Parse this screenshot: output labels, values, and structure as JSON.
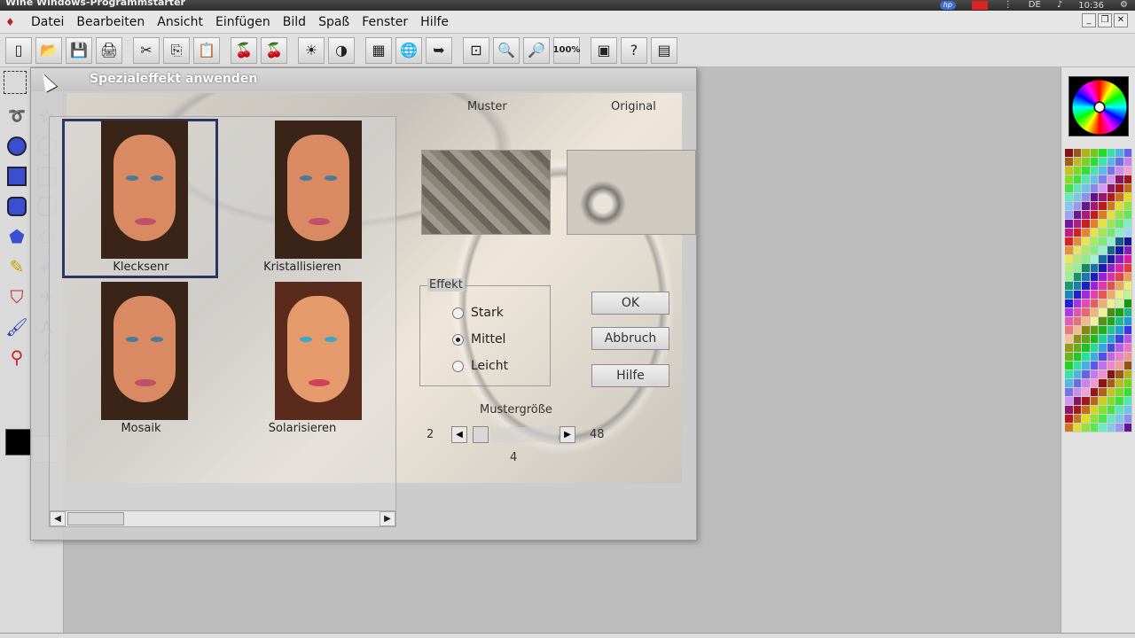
{
  "titlebar": {
    "title": "Wine Windows-Programmstarter",
    "tray": [
      "hp",
      "",
      "",
      "DE",
      "",
      "10:36"
    ]
  },
  "menu": {
    "items": [
      "Datei",
      "Bearbeiten",
      "Ansicht",
      "Einfügen",
      "Bild",
      "Spaß",
      "Fenster",
      "Hilfe"
    ]
  },
  "toolbar": {
    "buttons": [
      {
        "icon": "new-document-icon",
        "glyph": "▯"
      },
      {
        "icon": "open-folder-icon",
        "glyph": "📂"
      },
      {
        "icon": "save-disk-icon",
        "glyph": "💾"
      },
      {
        "icon": "scanner-icon",
        "glyph": "🖨"
      },
      {
        "icon": "cut-scissors-icon",
        "glyph": "✂"
      },
      {
        "icon": "copy-icon",
        "glyph": "⎘"
      },
      {
        "icon": "paste-icon",
        "glyph": "📋"
      },
      {
        "icon": "red-eye-icon",
        "glyph": "🍒"
      },
      {
        "icon": "red-eye-fix-icon",
        "glyph": "🍒"
      },
      {
        "icon": "brightness-sun-icon",
        "glyph": "☀"
      },
      {
        "icon": "color-balance-icon",
        "glyph": "◑"
      },
      {
        "icon": "image-adjust-icon",
        "glyph": "▦"
      },
      {
        "icon": "globe-icon",
        "glyph": "🌐"
      },
      {
        "icon": "send-image-icon",
        "glyph": "➥"
      },
      {
        "icon": "zoom-fit-icon",
        "glyph": "⊡"
      },
      {
        "icon": "zoom-in-icon",
        "glyph": "🔍"
      },
      {
        "icon": "zoom-out-icon",
        "glyph": "🔎"
      },
      {
        "icon": "zoom-100-icon",
        "glyph": "100%"
      },
      {
        "icon": "screen-capture-icon",
        "glyph": "▣"
      },
      {
        "icon": "image-info-icon",
        "glyph": "?"
      },
      {
        "icon": "thumbnail-view-icon",
        "glyph": "▤"
      }
    ]
  },
  "dialog": {
    "title": "Spezialeffekt anwenden",
    "effects": [
      {
        "label": "Klecksenr"
      },
      {
        "label": "Kristallisieren"
      },
      {
        "label": "Mosaik"
      },
      {
        "label": "Solarisieren"
      }
    ],
    "preview_labels": {
      "muster": "Muster",
      "original": "Original"
    },
    "effect_group": {
      "title": "Effekt",
      "options": [
        "Stark",
        "Mittel",
        "Leicht"
      ],
      "selected": "Mittel"
    },
    "buttons": {
      "ok": "OK",
      "cancel": "Abbruch",
      "help": "Hilfe"
    },
    "pattern_size": {
      "label": "Mustergröße",
      "min": "2",
      "max": "48",
      "value": "4"
    }
  },
  "colors": {
    "accent": "#2b3560",
    "swatch_foreground": "#000000",
    "swatch_background": "#ffffff"
  }
}
